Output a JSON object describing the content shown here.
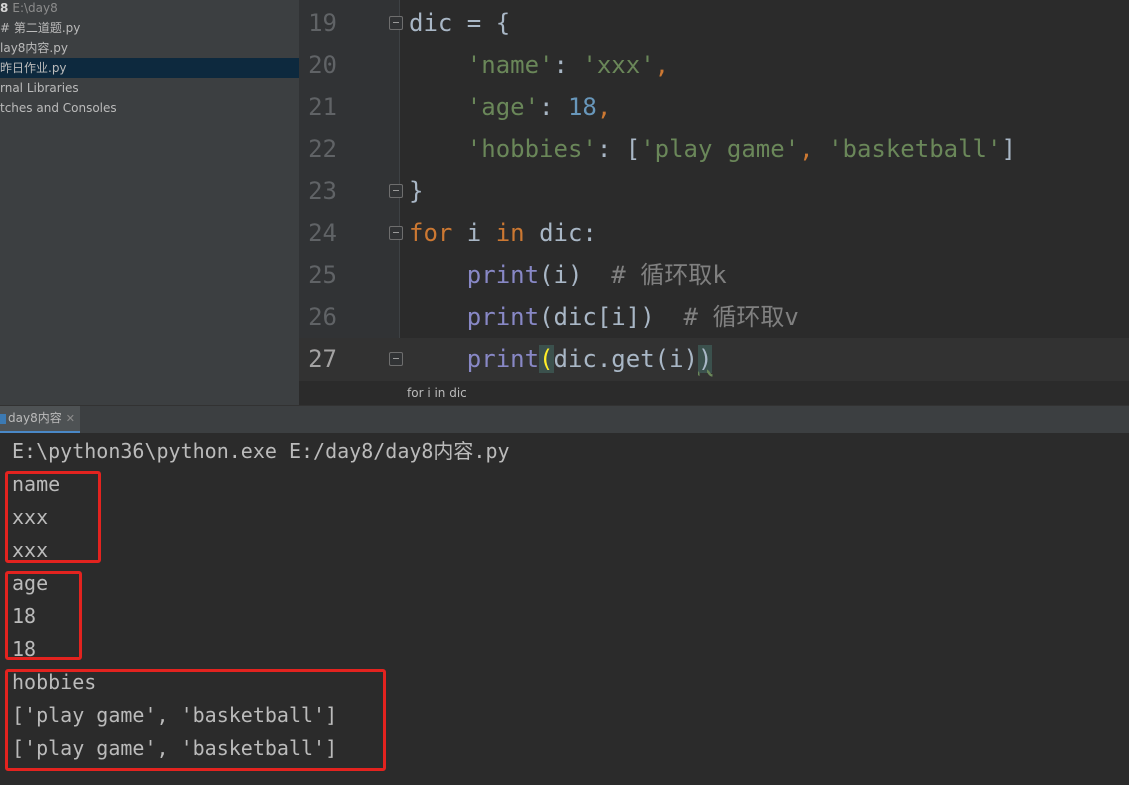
{
  "project_tree": {
    "root_name": "8",
    "root_path": "E:\\day8",
    "items": [
      {
        "label": "# 第二道题.py"
      },
      {
        "label": "lay8内容.py"
      },
      {
        "label": "昨日作业.py"
      },
      {
        "label": "rnal Libraries"
      },
      {
        "label": "tches and Consoles"
      }
    ],
    "selected_index": 2
  },
  "editor": {
    "line_numbers": [
      "19",
      "20",
      "21",
      "22",
      "23",
      "24",
      "25",
      "26",
      "27"
    ],
    "current_line": "27",
    "breadcrumb": "for i in dic",
    "code": {
      "l19": {
        "name": "dic",
        "op": " = {"
      },
      "l20": {
        "key": "'name'",
        "colon": ": ",
        "value": "'xxx'",
        "comma": ","
      },
      "l21": {
        "key": "'age'",
        "colon": ": ",
        "value": "18",
        "comma": ","
      },
      "l22": {
        "key": "'hobbies'",
        "colon": ": [",
        "v1": "'play game'",
        "sep": ", ",
        "v2": "'basketball'",
        "close": "]"
      },
      "l23": {
        "text": "}"
      },
      "l24": {
        "kw_for": "for",
        "var": " i ",
        "kw_in": "in",
        "rest": " dic:"
      },
      "l25": {
        "fn": "print",
        "args": "(i)",
        "comment": "  # 循环取k"
      },
      "l26": {
        "fn": "print",
        "args": "(dic[i])",
        "comment": "  # 循环取v"
      },
      "l27": {
        "fn": "print",
        "open": "(",
        "mid": "dic.get(i)",
        "close": ")"
      }
    }
  },
  "run": {
    "tab_label": "day8内容",
    "command": "E:\\python36\\python.exe E:/day8/day8内容.py",
    "output": [
      "name",
      "xxx",
      "xxx",
      "age",
      "18",
      "18",
      "hobbies",
      "['play game', 'basketball']",
      "['play game', 'basketball']"
    ]
  },
  "colors": {
    "highlight_box": "#e3231f",
    "keyword": "#cc7832",
    "string": "#6a8759",
    "number": "#6897bb",
    "builtin": "#8888c6"
  }
}
